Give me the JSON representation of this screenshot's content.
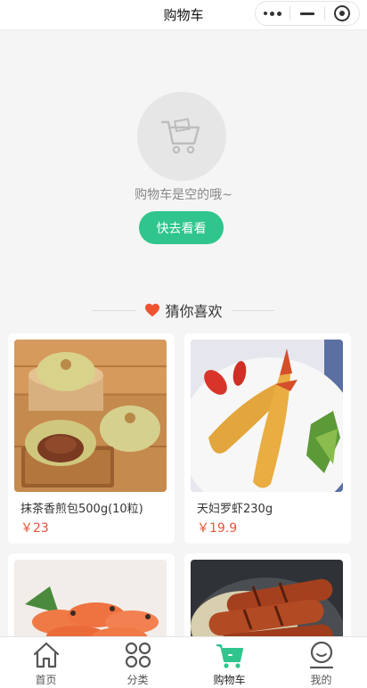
{
  "header": {
    "title": "购物车"
  },
  "empty": {
    "message": "购物车是空的哦~",
    "button_label": "快去看看"
  },
  "recommend": {
    "title": "猜你喜欢"
  },
  "products": [
    {
      "name": "抹茶香煎包500g(10粒)",
      "price": "￥23"
    },
    {
      "name": "天妇罗虾230g",
      "price": "￥19.9"
    },
    {
      "name": "",
      "price": ""
    },
    {
      "name": "",
      "price": ""
    }
  ],
  "tabbar": [
    {
      "label": "首页",
      "icon": "home-icon"
    },
    {
      "label": "分类",
      "icon": "category-icon"
    },
    {
      "label": "购物车",
      "icon": "cart-icon"
    },
    {
      "label": "我的",
      "icon": "profile-icon"
    }
  ],
  "colors": {
    "accent": "#2fc58d",
    "price": "#e8543b",
    "heart": "#f0522f"
  }
}
